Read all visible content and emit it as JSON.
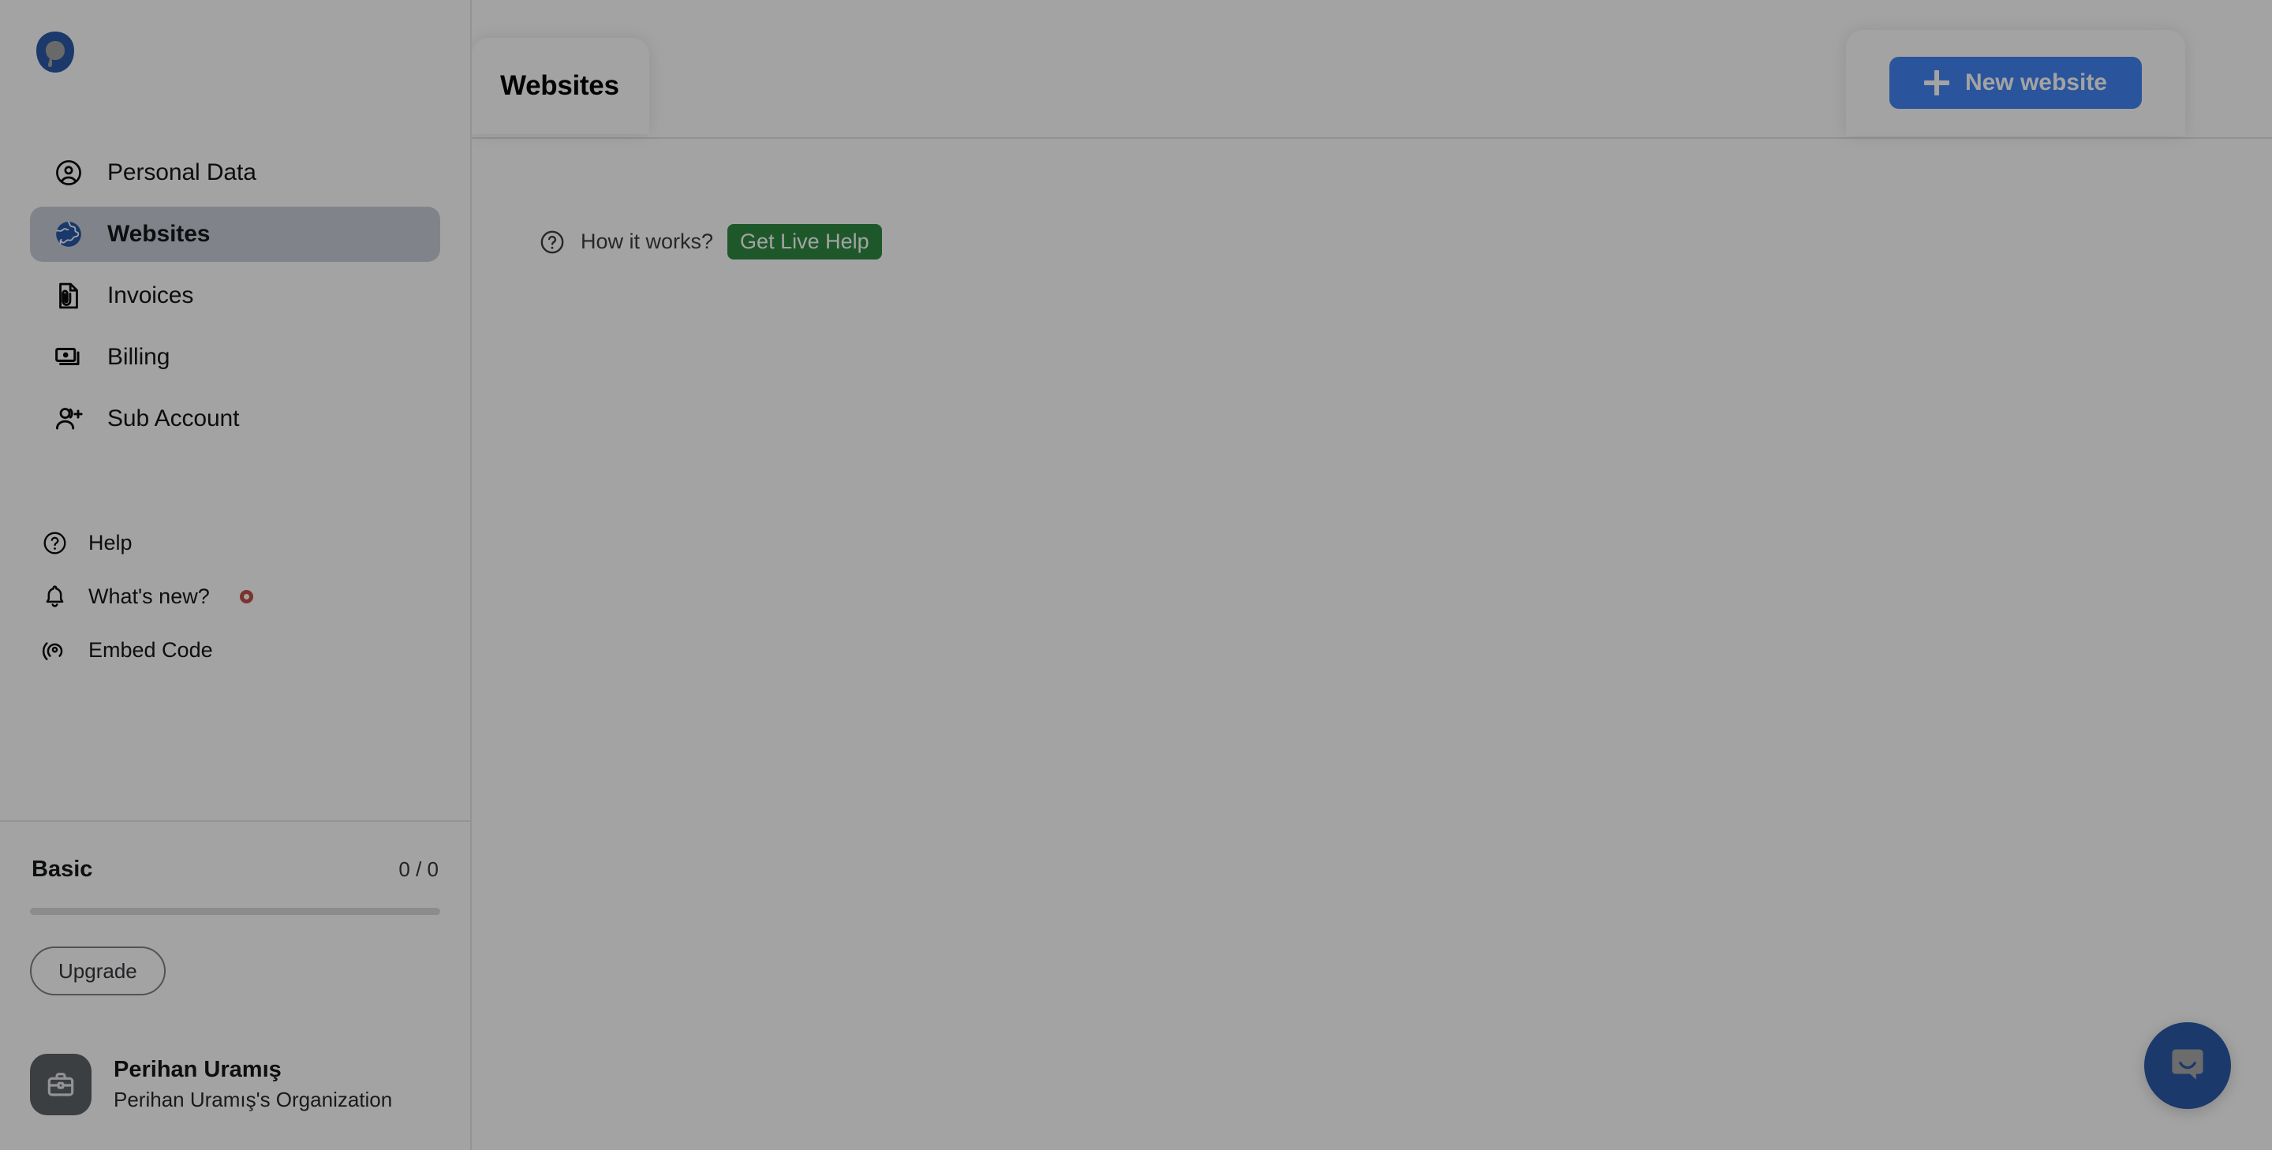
{
  "app": {
    "logo_icon": "popupsmart-logo-icon",
    "accent_blue": "#4285f4",
    "logo_blue": "#2c5aa8",
    "active_nav_bg": "#c9cfd8",
    "badge_green": "#2f8a43",
    "notification_red": "#c0504a"
  },
  "sidebar": {
    "primary_items": [
      {
        "label": "Personal Data",
        "icon": "user-circle-icon",
        "active": false
      },
      {
        "label": "Websites",
        "icon": "globe-icon",
        "active": true
      },
      {
        "label": "Invoices",
        "icon": "document-paperclip-icon",
        "active": false
      },
      {
        "label": "Billing",
        "icon": "banknote-icon",
        "active": false
      },
      {
        "label": "Sub Account",
        "icon": "person-plus-icon",
        "active": false
      }
    ],
    "secondary_items": [
      {
        "label": "Help",
        "icon": "question-circle-icon",
        "has_dot": false
      },
      {
        "label": "What's new?",
        "icon": "bell-icon",
        "has_dot": true
      },
      {
        "label": "Embed Code",
        "icon": "broadcast-icon",
        "has_dot": false
      }
    ],
    "plan": {
      "name": "Basic",
      "usage": "0 / 0",
      "progress_percent": 0,
      "upgrade_label": "Upgrade"
    },
    "account": {
      "avatar_icon": "briefcase-icon",
      "name": "Perihan Uramış",
      "organization": "Perihan Uramış's Organization"
    }
  },
  "main": {
    "page_title": "Websites",
    "new_website_label": "New website",
    "new_website_icon": "plus-icon",
    "how_it_works": {
      "icon": "question-circle-icon",
      "text": "How it works?",
      "badge_label": "Get Live Help"
    },
    "chat_launcher_icon": "chat-bubble-icon"
  }
}
